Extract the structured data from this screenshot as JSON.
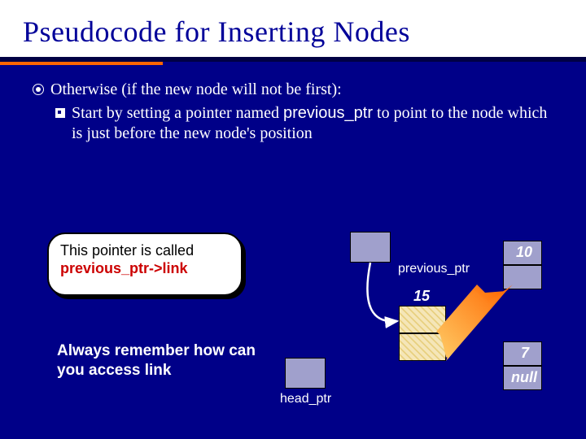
{
  "title": "Pseudocode for Inserting Nodes",
  "bullets": {
    "b1": "Otherwise (if the new node will not be first):",
    "b2_pre": "Start by setting a pointer named ",
    "b2_code": "previous_ptr",
    "b2_post": " to point to the node which is just before the new node's position"
  },
  "callout": {
    "line1": "This pointer is called",
    "line2": "previous_ptr->link"
  },
  "remember": "Always remember how can you access link",
  "labels": {
    "previous_ptr": "previous_ptr",
    "head_ptr": "head_ptr"
  },
  "values": {
    "ten": "10",
    "fifteen": "15",
    "seven": "7",
    "null": "null"
  }
}
